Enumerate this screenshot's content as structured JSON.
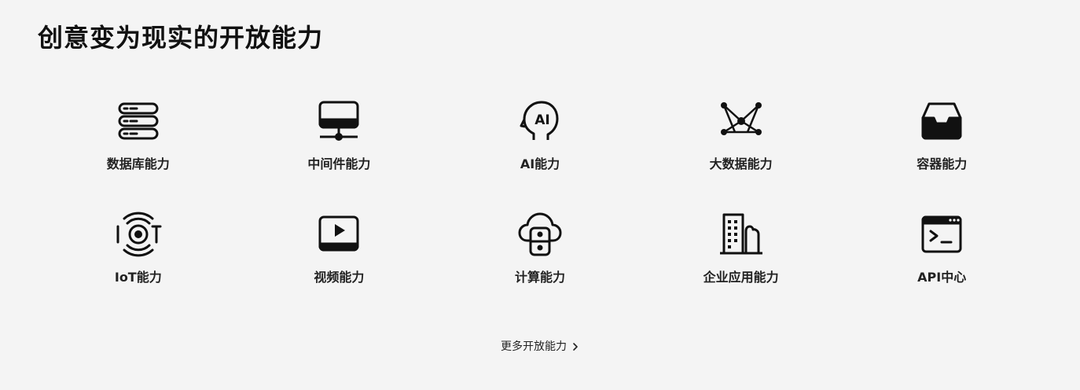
{
  "page": {
    "title": "创意变为现实的开放能力",
    "more_link": "更多开放能力"
  },
  "capabilities": [
    {
      "label": "数据库能力",
      "icon": "database-icon"
    },
    {
      "label": "中间件能力",
      "icon": "middleware-icon"
    },
    {
      "label": "AI能力",
      "icon": "ai-head-icon"
    },
    {
      "label": "大数据能力",
      "icon": "bigdata-network-icon"
    },
    {
      "label": "容器能力",
      "icon": "container-tray-icon"
    },
    {
      "label": "IoT能力",
      "icon": "iot-signal-icon"
    },
    {
      "label": "视频能力",
      "icon": "video-play-icon"
    },
    {
      "label": "计算能力",
      "icon": "cloud-compute-icon"
    },
    {
      "label": "企业应用能力",
      "icon": "enterprise-building-icon"
    },
    {
      "label": "API中心",
      "icon": "api-terminal-icon"
    }
  ],
  "colors": {
    "background": "#f4f4f4",
    "text": "#111111",
    "icon": "#111111"
  }
}
